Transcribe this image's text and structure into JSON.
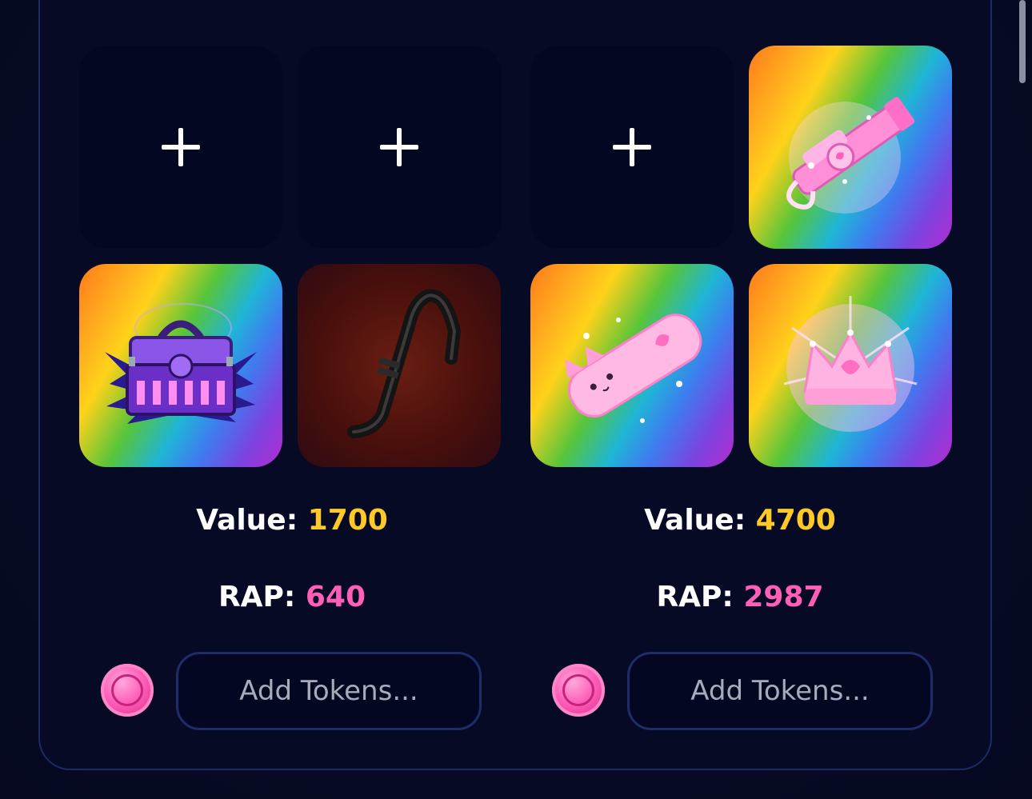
{
  "offers": [
    {
      "slots": [
        {
          "type": "empty",
          "add_symbol": "+"
        },
        {
          "type": "empty",
          "add_symbol": "+"
        },
        {
          "type": "item",
          "item": "purple-chest-icon",
          "background": "rainbow"
        },
        {
          "type": "item",
          "item": "black-crowbar-icon",
          "background": "dark-red"
        }
      ],
      "value_label": "Value:",
      "value": "1700",
      "rap_label": "RAP:",
      "rap": "640",
      "token_placeholder": "Add Tokens...",
      "coin_icon": "pink-token-coin-icon"
    },
    {
      "slots": [
        {
          "type": "empty",
          "add_symbol": "+"
        },
        {
          "type": "item",
          "item": "pink-heart-gun-icon",
          "background": "rainbow"
        },
        {
          "type": "item",
          "item": "pink-cat-sword-icon",
          "background": "rainbow"
        },
        {
          "type": "item",
          "item": "pink-heart-crown-icon",
          "background": "rainbow"
        }
      ],
      "value_label": "Value:",
      "value": "4700",
      "rap_label": "RAP:",
      "rap": "2987",
      "token_placeholder": "Add Tokens...",
      "coin_icon": "pink-token-coin-icon"
    }
  ],
  "colors": {
    "background": "#060a25",
    "panel_border": "#1d2a66",
    "value_color": "#ffc928",
    "rap_color": "#ff5fb7",
    "text_white": "#ffffff",
    "placeholder_gray": "#a8abbc"
  }
}
